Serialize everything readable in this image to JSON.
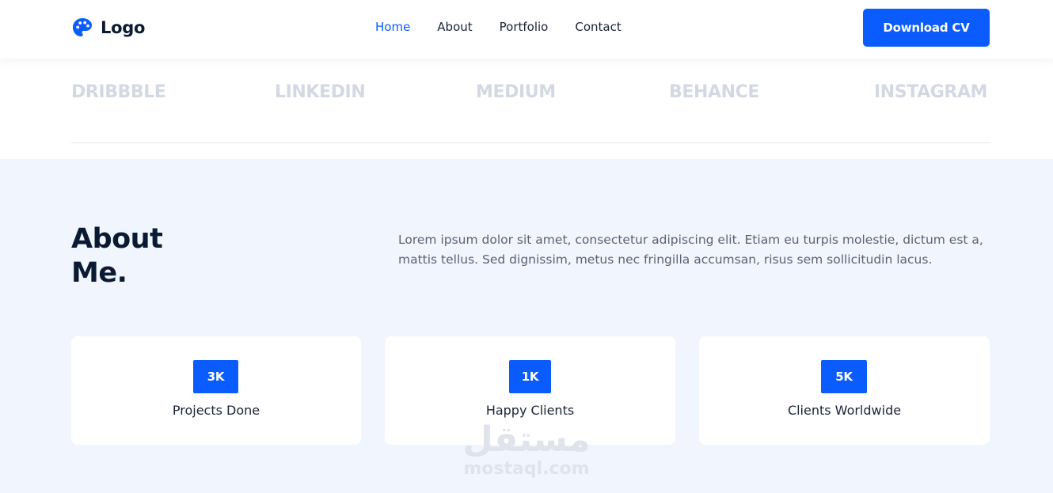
{
  "header": {
    "logo_text": "Logo",
    "logo_icon": "palette-icon",
    "nav": [
      {
        "label": "Home",
        "active": true
      },
      {
        "label": "About",
        "active": false
      },
      {
        "label": "Portfolio",
        "active": false
      },
      {
        "label": "Contact",
        "active": false
      }
    ],
    "cta_label": "Download CV"
  },
  "brands": [
    "DRIBBBLE",
    "LINKEDIN",
    "MEDIUM",
    "BEHANCE",
    "INSTAGRAM"
  ],
  "about": {
    "title_line1": "About",
    "title_line2": "Me.",
    "paragraph": "Lorem ipsum dolor sit amet, consectetur adipiscing elit. Etiam eu turpis molestie, dictum est a, mattis tellus. Sed dignissim, metus nec fringilla accumsan, risus sem sollicitudin lacus."
  },
  "stats": [
    {
      "value": "3K",
      "label": "Projects Done"
    },
    {
      "value": "1K",
      "label": "Happy Clients"
    },
    {
      "value": "5K",
      "label": "Clients Worldwide"
    }
  ],
  "watermark": {
    "arabic": "مستقل",
    "latin": "mostaql.com"
  },
  "colors": {
    "accent": "#0a5cff",
    "section_bg": "#f1f5fd",
    "heading": "#0b1a33",
    "brand_logo_gray": "#d3d9e3"
  }
}
